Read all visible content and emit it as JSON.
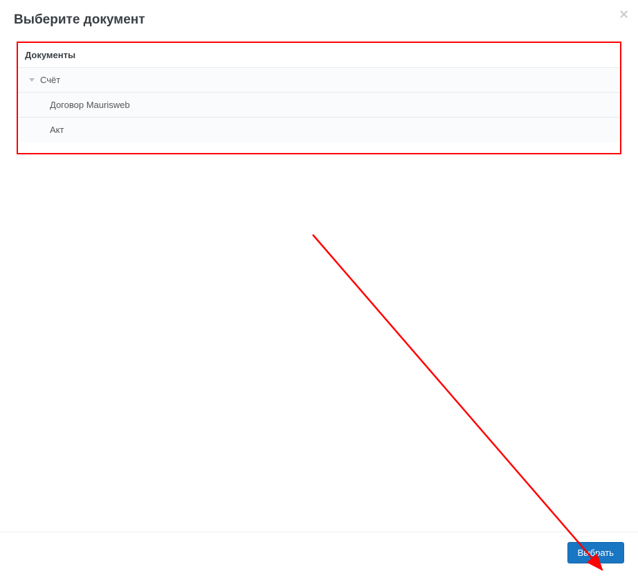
{
  "modal": {
    "title": "Выберите документ",
    "close_label": "×"
  },
  "tree": {
    "header": "Документы",
    "items": [
      {
        "label": "Счёт"
      },
      {
        "label": "Договор Maurisweb"
      },
      {
        "label": "Акт"
      }
    ]
  },
  "footer": {
    "select_label": "Выбрать"
  }
}
